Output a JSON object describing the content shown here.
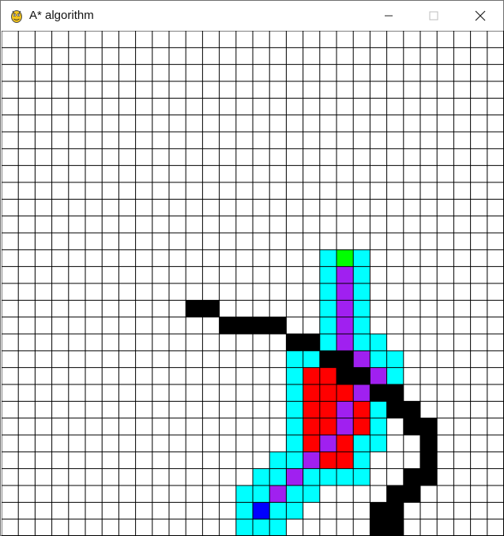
{
  "window": {
    "title": "A* algorithm",
    "icon": "pygame-snake-icon",
    "controls": [
      "minimize",
      "maximize",
      "close"
    ]
  },
  "grid": {
    "cols": 30,
    "rows": 30,
    "line_color": "#000000",
    "colors": {
      "empty": "#ffffff",
      "barrier": "#000000",
      "open": "#00ffff",
      "closed": "#ff0000",
      "path": "#a020f0",
      "start": "#0000ff",
      "end": "#00ff00"
    },
    "cells": {
      "barrier": [
        [
          11,
          16
        ],
        [
          12,
          16
        ],
        [
          13,
          17
        ],
        [
          14,
          17
        ],
        [
          15,
          17
        ],
        [
          16,
          17
        ],
        [
          17,
          18
        ],
        [
          18,
          18
        ],
        [
          19,
          19
        ],
        [
          20,
          19
        ],
        [
          20,
          20
        ],
        [
          21,
          20
        ],
        [
          22,
          21
        ],
        [
          23,
          21
        ],
        [
          23,
          22
        ],
        [
          24,
          22
        ],
        [
          24,
          23
        ],
        [
          25,
          23
        ],
        [
          25,
          24
        ],
        [
          25,
          25
        ],
        [
          25,
          26
        ],
        [
          24,
          26
        ],
        [
          24,
          27
        ],
        [
          23,
          27
        ],
        [
          23,
          28
        ],
        [
          22,
          28
        ],
        [
          22,
          29
        ],
        [
          23,
          29
        ]
      ],
      "open": [
        [
          19,
          13
        ],
        [
          21,
          13
        ],
        [
          19,
          14
        ],
        [
          21,
          14
        ],
        [
          19,
          15
        ],
        [
          21,
          15
        ],
        [
          19,
          16
        ],
        [
          21,
          16
        ],
        [
          19,
          17
        ],
        [
          21,
          17
        ],
        [
          19,
          18
        ],
        [
          21,
          18
        ],
        [
          22,
          18
        ],
        [
          17,
          19
        ],
        [
          18,
          19
        ],
        [
          22,
          19
        ],
        [
          23,
          19
        ],
        [
          17,
          20
        ],
        [
          23,
          20
        ],
        [
          17,
          21
        ],
        [
          17,
          22
        ],
        [
          22,
          22
        ],
        [
          17,
          23
        ],
        [
          22,
          23
        ],
        [
          17,
          24
        ],
        [
          21,
          24
        ],
        [
          22,
          24
        ],
        [
          16,
          25
        ],
        [
          17,
          25
        ],
        [
          21,
          25
        ],
        [
          15,
          26
        ],
        [
          16,
          26
        ],
        [
          18,
          26
        ],
        [
          19,
          26
        ],
        [
          20,
          26
        ],
        [
          21,
          26
        ],
        [
          14,
          27
        ],
        [
          15,
          27
        ],
        [
          17,
          27
        ],
        [
          18,
          27
        ],
        [
          14,
          28
        ],
        [
          16,
          28
        ],
        [
          17,
          28
        ],
        [
          14,
          29
        ],
        [
          15,
          29
        ],
        [
          16,
          29
        ]
      ],
      "closed": [
        [
          18,
          20
        ],
        [
          19,
          20
        ],
        [
          18,
          21
        ],
        [
          19,
          21
        ],
        [
          20,
          21
        ],
        [
          18,
          22
        ],
        [
          19,
          22
        ],
        [
          21,
          22
        ],
        [
          18,
          23
        ],
        [
          19,
          23
        ],
        [
          21,
          23
        ],
        [
          18,
          24
        ],
        [
          20,
          24
        ],
        [
          19,
          25
        ],
        [
          20,
          25
        ]
      ],
      "path": [
        [
          20,
          14
        ],
        [
          20,
          15
        ],
        [
          20,
          16
        ],
        [
          20,
          17
        ],
        [
          20,
          18
        ],
        [
          21,
          19
        ],
        [
          22,
          20
        ],
        [
          21,
          21
        ],
        [
          20,
          22
        ],
        [
          20,
          23
        ],
        [
          19,
          24
        ],
        [
          18,
          25
        ],
        [
          17,
          26
        ],
        [
          16,
          27
        ],
        [
          15,
          28
        ]
      ],
      "start": [
        [
          15,
          28
        ]
      ],
      "end": [
        [
          20,
          13
        ]
      ]
    }
  }
}
